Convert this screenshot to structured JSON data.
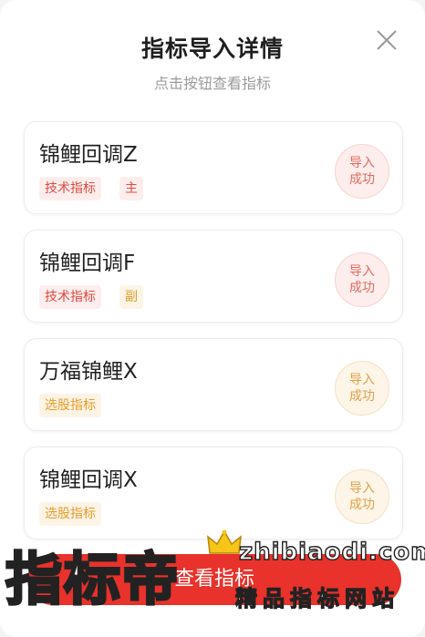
{
  "dialog": {
    "title": "指标导入详情",
    "subtitle": "点击按钮查看指标"
  },
  "indicators": [
    {
      "name": "锦鲤回调Z",
      "tags": [
        "技术指标",
        "主"
      ],
      "status": [
        "导入",
        "成功"
      ],
      "tone": "red"
    },
    {
      "name": "锦鲤回调F",
      "tags": [
        "技术指标",
        "副"
      ],
      "status": [
        "导入",
        "成功"
      ],
      "tone": "red"
    },
    {
      "name": "万福锦鲤X",
      "tags": [
        "选股指标"
      ],
      "status": [
        "导入",
        "成功"
      ],
      "tone": "gold"
    },
    {
      "name": "锦鲤回调X",
      "tags": [
        "选股指标"
      ],
      "status": [
        "导入",
        "成功"
      ],
      "tone": "gold"
    }
  ],
  "bottom_button": {
    "label": "查看指标"
  },
  "watermark": {
    "big": "指标帝",
    "url": "zhibiaodi.com",
    "sub": "精品指标网站"
  },
  "colors": {
    "accent": "#e8322b",
    "tag_red": "#e0493f",
    "tag_gold": "#e89b2b"
  }
}
